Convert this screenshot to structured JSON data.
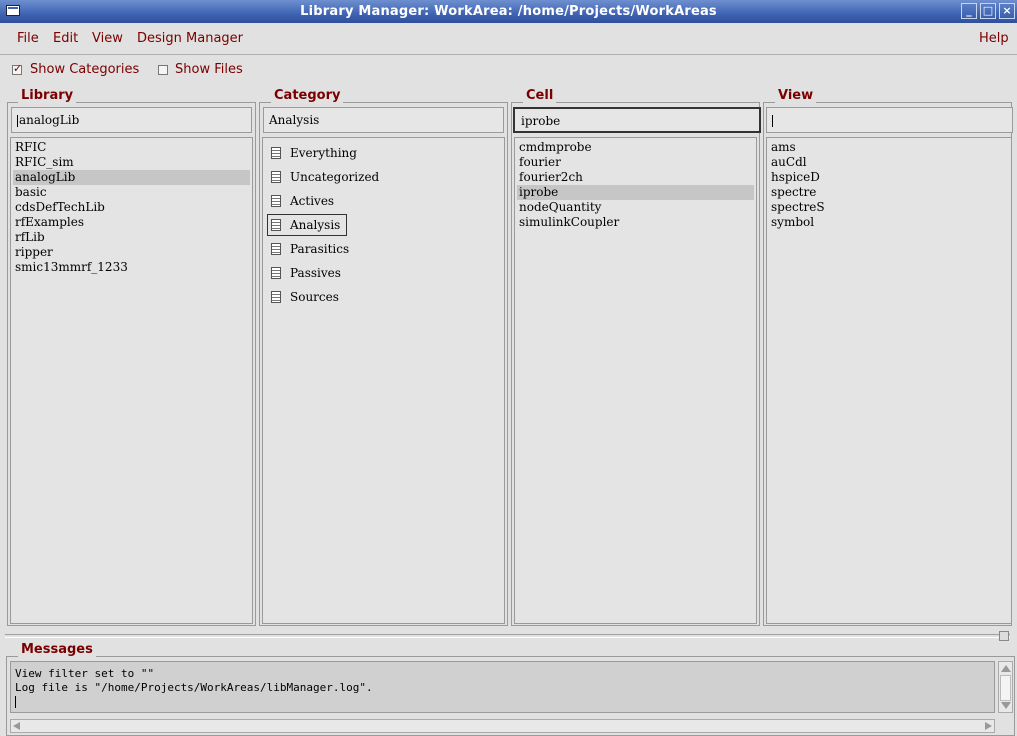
{
  "window": {
    "title": "Library Manager: WorkArea: /home/Projects/WorkAreas",
    "buttons": {
      "minimize": "_",
      "maximize": "□",
      "close": "×"
    }
  },
  "menubar": {
    "file": "File",
    "edit": "Edit",
    "view": "View",
    "design_manager": "Design Manager",
    "help": "Help"
  },
  "options": {
    "show_categories": {
      "label": "Show Categories",
      "checked": true
    },
    "show_files": {
      "label": "Show Files",
      "checked": false
    }
  },
  "library": {
    "title": "Library",
    "filter": "analogLib",
    "items": [
      "RFIC",
      "RFIC_sim",
      "analogLib",
      "basic",
      "cdsDefTechLib",
      "rfExamples",
      "rfLib",
      "ripper",
      "smic13mmrf_1233"
    ],
    "selected": "analogLib"
  },
  "category": {
    "title": "Category",
    "filter": "Analysis",
    "items": [
      "Everything",
      "Uncategorized",
      "Actives",
      "Analysis",
      "Parasitics",
      "Passives",
      "Sources"
    ],
    "selected": "Analysis"
  },
  "cell": {
    "title": "Cell",
    "filter": "iprobe",
    "items": [
      "cmdmprobe",
      "fourier",
      "fourier2ch",
      "iprobe",
      "nodeQuantity",
      "simulinkCoupler"
    ],
    "selected": "iprobe"
  },
  "view": {
    "title": "View",
    "filter": "",
    "items": [
      "ams",
      "auCdl",
      "hspiceD",
      "spectre",
      "spectreS",
      "symbol"
    ]
  },
  "messages": {
    "title": "Messages",
    "lines": [
      "View filter set to \"\"",
      "Log file is \"/home/Projects/WorkAreas/libManager.log\"."
    ]
  }
}
